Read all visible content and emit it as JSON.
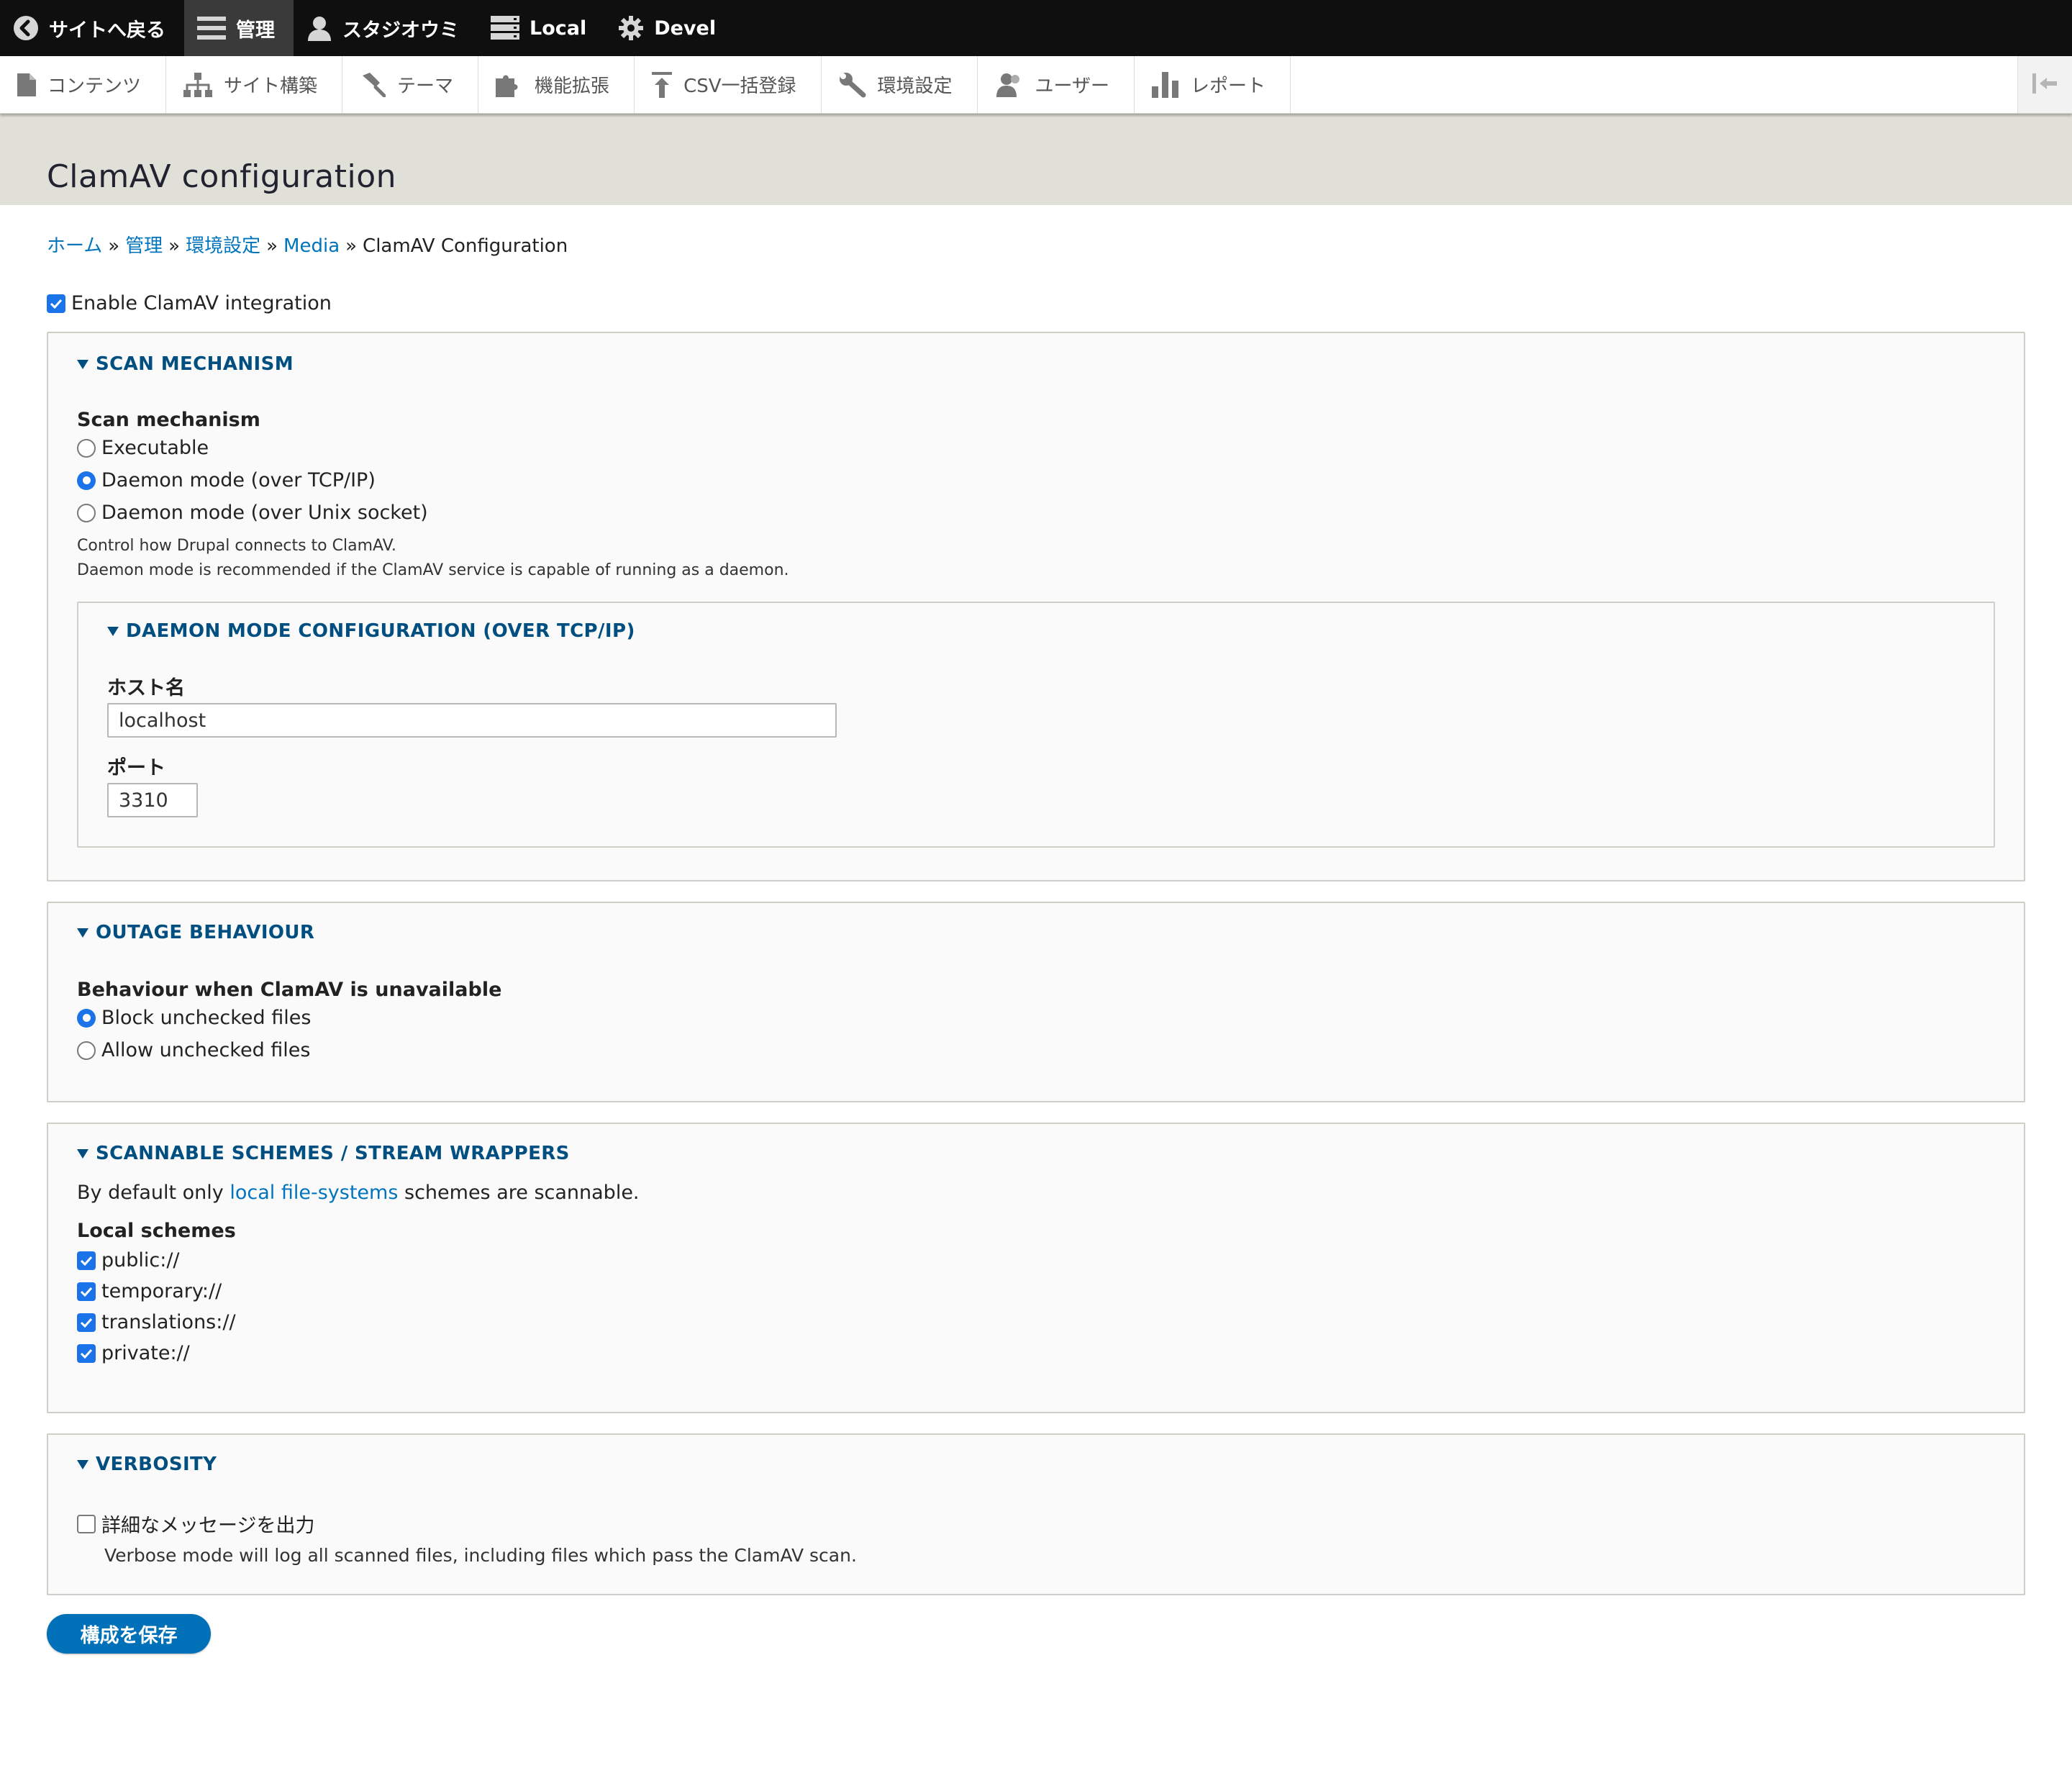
{
  "toolbar": {
    "back": "サイトへ戻る",
    "manage": "管理",
    "user": "スタジオウミ",
    "local": "Local",
    "devel": "Devel"
  },
  "tray": {
    "items": [
      "コンテンツ",
      "サイト構築",
      "テーマ",
      "機能拡張",
      "CSV一括登録",
      "環境設定",
      "ユーザー",
      "レポート"
    ]
  },
  "page": {
    "title": "ClamAV configuration"
  },
  "breadcrumb": {
    "home": "ホーム",
    "admin": "管理",
    "config": "環境設定",
    "media": "Media",
    "current": "ClamAV Configuration",
    "sep": "»"
  },
  "enable": {
    "label": "Enable ClamAV integration",
    "checked": true
  },
  "scan": {
    "legend": "SCAN MECHANISM",
    "label": "Scan mechanism",
    "options": [
      "Executable",
      "Daemon mode (over TCP/IP)",
      "Daemon mode (over Unix socket)"
    ],
    "selected": 1,
    "desc1": "Control how Drupal connects to ClamAV.",
    "desc2": "Daemon mode is recommended if the ClamAV service is capable of running as a daemon.",
    "daemon": {
      "legend": "DAEMON MODE CONFIGURATION (OVER TCP/IP)",
      "host_label": "ホスト名",
      "host_value": "localhost",
      "port_label": "ポート",
      "port_value": "3310"
    }
  },
  "outage": {
    "legend": "OUTAGE BEHAVIOUR",
    "label": "Behaviour when ClamAV is unavailable",
    "options": [
      "Block unchecked files",
      "Allow unchecked files"
    ],
    "selected": 0
  },
  "schemes": {
    "legend": "SCANNABLE SCHEMES / STREAM WRAPPERS",
    "intro_pre": "By default only ",
    "intro_link": "local file-systems",
    "intro_post": " schemes are scannable.",
    "label": "Local schemes",
    "items": [
      "public://",
      "temporary://",
      "translations://",
      "private://"
    ]
  },
  "verbosity": {
    "legend": "VERBOSITY",
    "label": "詳細なメッセージを出力",
    "desc": "Verbose mode will log all scanned files, including files which pass the ClamAV scan.",
    "checked": false
  },
  "actions": {
    "save": "構成を保存"
  },
  "colors": {
    "accent": "#0071b8",
    "link": "#0074bd",
    "legend": "#004f80",
    "toolbar": "#0f0f0f"
  }
}
